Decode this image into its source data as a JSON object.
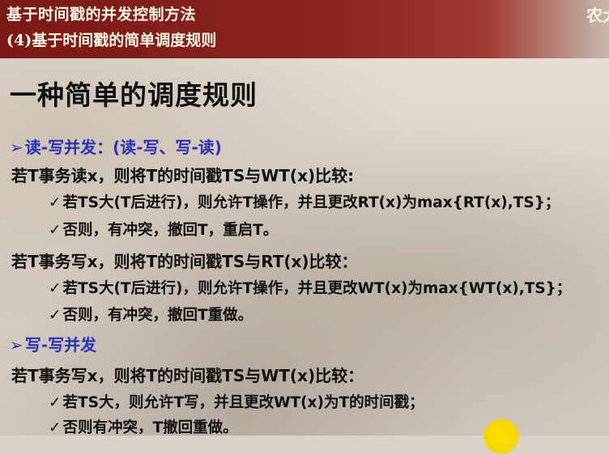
{
  "header": {
    "title": "基于时间戳的并发控制方法",
    "subtitle": "(4)基于时间戳的简单调度规则",
    "corner_text": "农大"
  },
  "slide": {
    "title": "一种简单的调度规则",
    "section1": {
      "marker": "➢",
      "heading": "读-写并发：(读-写、写-读)",
      "rule1": "若T事务读x，则将T的时间戳TS与WT(x)比较:",
      "rule1_items": [
        "若TS大(T后进行)，则允许T操作，并且更改RT(x)为max{RT(x),TS}；",
        "否则，有冲突，撤回T，重启T。"
      ],
      "rule2": "若T事务写x，则将T的时间戳TS与RT(x)比较：",
      "rule2_items": [
        "若TS大(T后进行)，则允许T操作，并且更改WT(x)为max{WT(x),TS}；",
        "否则，有冲突，撤回T重做。"
      ]
    },
    "section2": {
      "marker": "➢",
      "heading": "写-写并发",
      "rule1": "若T事务写x，则将T的时间戳TS与WT(x)比较：",
      "rule1_items": [
        "若TS大，则允许T写，并且更改WT(x)为T的时间戳；",
        "否则有冲突，T撤回重做。"
      ]
    },
    "check_marker": "✓"
  },
  "colors": {
    "header_bg": "#7a1a17",
    "header_text": "#fff7e6",
    "section_heading": "#2b32b8",
    "body_text": "#111111",
    "pointer_highlight": "#ffe100"
  }
}
